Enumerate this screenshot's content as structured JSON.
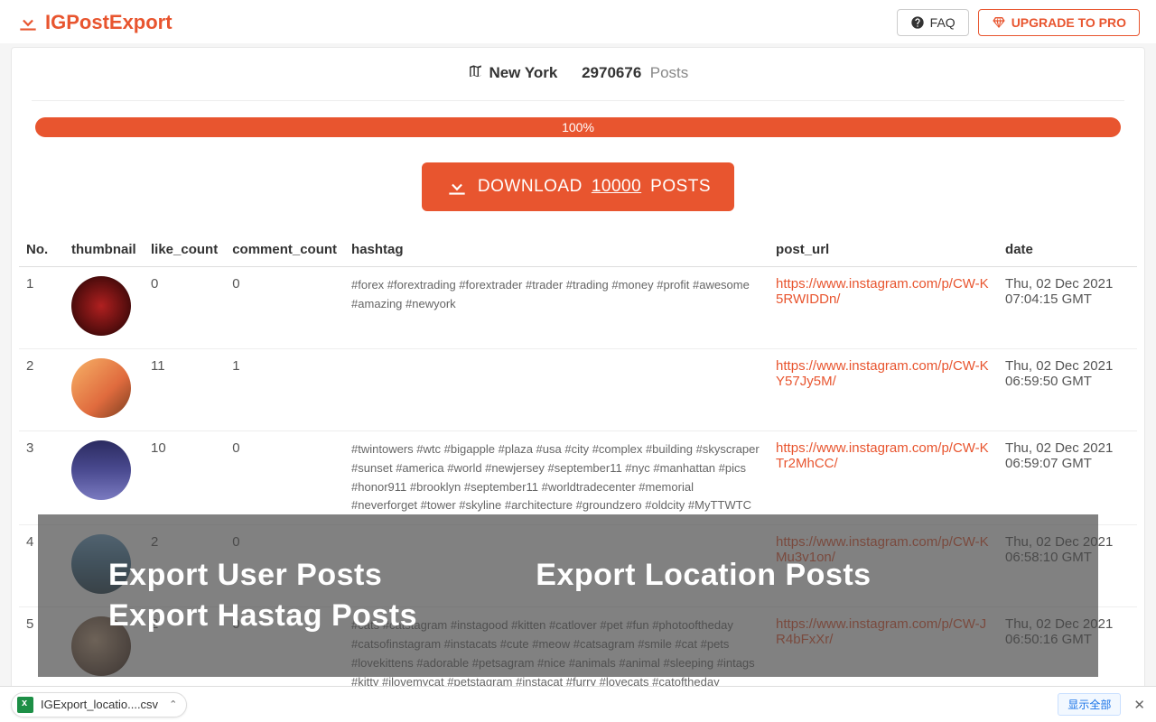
{
  "brand": "IGPostExport",
  "header": {
    "faq_label": "FAQ",
    "upgrade_label": "UPGRADE TO PRO"
  },
  "summary": {
    "location": "New York",
    "count": "2970676",
    "posts_label": "Posts"
  },
  "progress": {
    "percent_label": "100%"
  },
  "download": {
    "prefix": "DOWNLOAD",
    "count": "10000",
    "suffix": "POSTS"
  },
  "table": {
    "headers": {
      "no": "No.",
      "thumbnail": "thumbnail",
      "like_count": "like_count",
      "comment_count": "comment_count",
      "hashtag": "hashtag",
      "post_url": "post_url",
      "date": "date"
    },
    "rows": [
      {
        "no": "1",
        "like_count": "0",
        "comment_count": "0",
        "hashtag": "#forex #forextrading #forextrader #trader #trading #money #profit #awesome #amazing #newyork",
        "post_url": "https://www.instagram.com/p/CW-K5RWIDDn/",
        "date": "Thu, 02 Dec 2021 07:04:15 GMT",
        "thumb_class": "t1"
      },
      {
        "no": "2",
        "like_count": "11",
        "comment_count": "1",
        "hashtag": "",
        "post_url": "https://www.instagram.com/p/CW-KY57Jy5M/",
        "date": "Thu, 02 Dec 2021 06:59:50 GMT",
        "thumb_class": "t2"
      },
      {
        "no": "3",
        "like_count": "10",
        "comment_count": "0",
        "hashtag": "#twintowers #wtc #bigapple #plaza #usa #city #complex #building #skyscraper #sunset #america #world #newjersey #september11 #nyc #manhattan #pics #honor911 #brooklyn #september11 #worldtradecenter #memorial #neverforget #tower #skyline #architecture #groundzero #oldcity #MyTTWTC",
        "post_url": "https://www.instagram.com/p/CW-KTr2MhCC/",
        "date": "Thu, 02 Dec 2021 06:59:07 GMT",
        "thumb_class": "t3"
      },
      {
        "no": "4",
        "like_count": "2",
        "comment_count": "0",
        "hashtag": "",
        "post_url": "https://www.instagram.com/p/CW-KMu3v1on/",
        "date": "Thu, 02 Dec 2021 06:58:10 GMT",
        "thumb_class": "t4"
      },
      {
        "no": "5",
        "like_count": "2",
        "comment_count": "0",
        "hashtag": "#cats #catstagram #instagood #kitten #catlover #pet #fun #photooftheday #catsofinstagram #instacats #cute #meow #catsagram #smile #cat #pets #lovekittens #adorable #petsagram #nice #animals #animal #sleeping #intags #kitty #ilovemycat #petstagram #instacat #furry #lovecats #catoftheday",
        "post_url": "https://www.instagram.com/p/CW-JR4bFxXr/",
        "date": "Thu, 02 Dec 2021 06:50:16 GMT",
        "thumb_class": "t5"
      }
    ]
  },
  "overlay": {
    "user": "Export User Posts",
    "location": "Export Location Posts",
    "hashtag": "Export Hastag Posts"
  },
  "dlbar": {
    "filename": "IGExport_locatio....csv",
    "showall": "显示全部"
  }
}
